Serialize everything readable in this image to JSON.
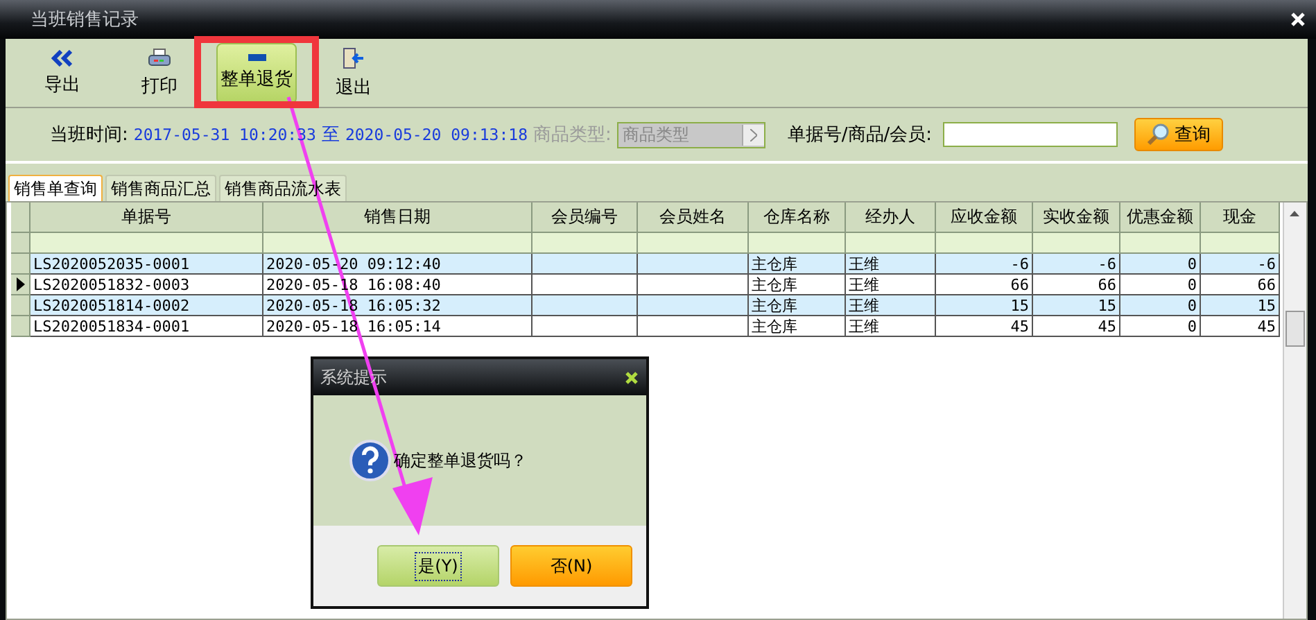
{
  "window": {
    "title": "当班销售记录"
  },
  "toolbar": [
    {
      "label": "导出",
      "selected": false
    },
    {
      "label": "打印",
      "selected": false
    },
    {
      "label": "整单退货",
      "selected": true
    },
    {
      "label": "退出",
      "selected": false
    }
  ],
  "filter": {
    "shift_label": "当班时间:",
    "start": "2017-05-31 10:20:33",
    "separator": "至",
    "end": "2020-05-20 09:13:18",
    "category_label": "商品类型:",
    "category_placeholder": "商品类型",
    "category_disabled": true,
    "search_label": "单据号/商品/会员:",
    "search_button": "查询"
  },
  "tabs": [
    {
      "label": "销售单查询",
      "selected": true
    },
    {
      "label": "销售商品汇总",
      "selected": false
    },
    {
      "label": "销售商品流水表",
      "selected": false
    }
  ],
  "table": {
    "columns": [
      "单据号",
      "销售日期",
      "会员编号",
      "会员姓名",
      "仓库名称",
      "经办人",
      "应收金额",
      "实收金额",
      "优惠金额",
      "现金"
    ],
    "rows": [
      {
        "current": false,
        "cells": [
          "LS2020052035-0001",
          "2020-05-20 09:12:40",
          "",
          "",
          "主仓库",
          "王维",
          "-6",
          "-6",
          "0",
          "-6"
        ]
      },
      {
        "current": true,
        "cells": [
          "LS2020051832-0003",
          "2020-05-18 16:08:40",
          "",
          "",
          "主仓库",
          "王维",
          "66",
          "66",
          "0",
          "66"
        ]
      },
      {
        "current": false,
        "cells": [
          "LS2020051814-0002",
          "2020-05-18 16:05:32",
          "",
          "",
          "主仓库",
          "王维",
          "15",
          "15",
          "0",
          "15"
        ]
      },
      {
        "current": false,
        "cells": [
          "LS2020051834-0001",
          "2020-05-18 16:05:14",
          "",
          "",
          "主仓库",
          "王维",
          "45",
          "45",
          "0",
          "45"
        ]
      }
    ]
  },
  "dialog": {
    "title": "系统提示",
    "message": "确定整单退货吗？",
    "buttons": [
      {
        "label": "是(Y)",
        "kind": "yes",
        "focused": true
      },
      {
        "label": "否(N)",
        "kind": "no",
        "focused": false
      }
    ]
  }
}
